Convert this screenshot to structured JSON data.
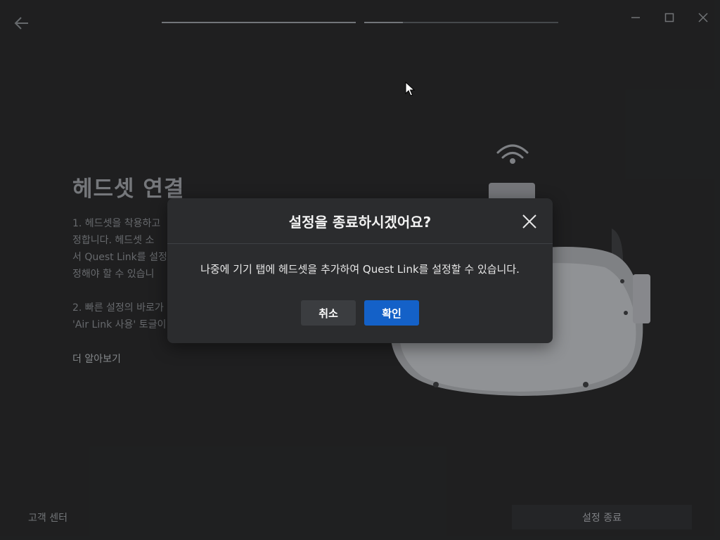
{
  "titlebar": {
    "back_icon": "arrow-left-icon",
    "progress": [
      1.0,
      0.2
    ],
    "controls": [
      "minimize-icon",
      "maximize-icon",
      "close-icon"
    ]
  },
  "page": {
    "title": "헤드셋 연결",
    "instructions": [
      [
        "1. 헤드셋을 착용하고",
        "정합니다. 헤드셋 소",
        "서 Quest Link를 설정",
        "정해야 할 수 있습니"
      ],
      [
        "2. 빠른 설정의 바로가",
        "'Air Link 사용' 토글이"
      ]
    ],
    "learn_more": "더 알아보기",
    "support": "고객 센터",
    "exit_button": "설정 종료"
  },
  "modal": {
    "title": "설정을 종료하시겠어요?",
    "body": "나중에 기기 탭에 헤드셋을 추가하여 Quest Link를 설정할 수 있습니다.",
    "cancel_label": "취소",
    "confirm_label": "확인"
  },
  "colors": {
    "background": "#262728",
    "modal": "#2b2c2e",
    "accent": "#1461c8"
  }
}
